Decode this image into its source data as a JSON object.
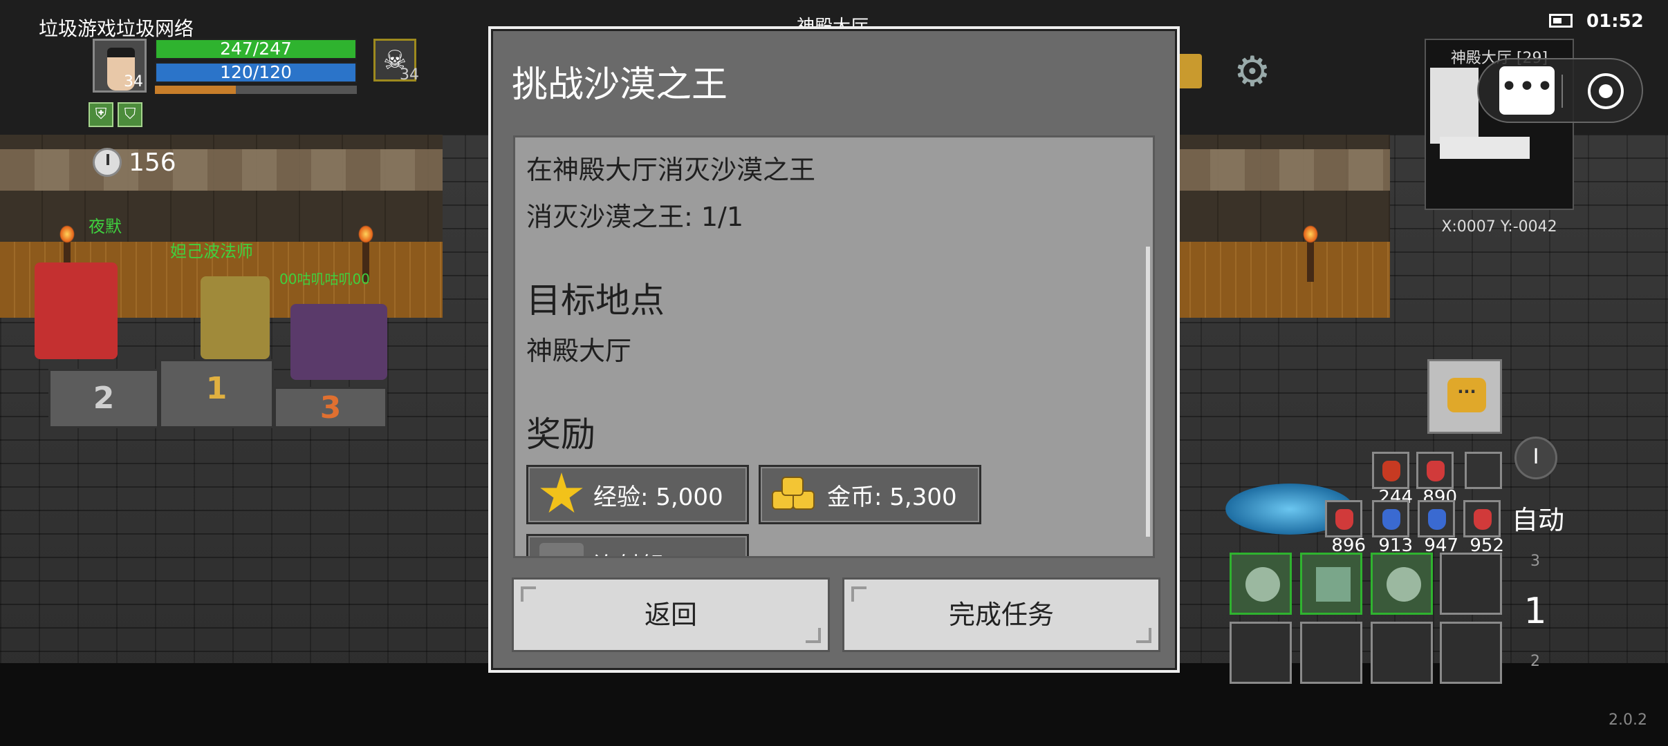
{
  "hud": {
    "app_title": "垃圾游戏垃圾网络",
    "player_level": "34",
    "hp": "247/247",
    "mp": "120/120",
    "experience_fraction": 0.4,
    "target_level": "34",
    "timer": "156"
  },
  "npcs": [
    "夜默",
    "妲己波法师",
    "00咕叽咕叽00"
  ],
  "podium": [
    "2",
    "1",
    "3"
  ],
  "location_title": "神殿大厅",
  "status_bar": {
    "time": "01:52"
  },
  "minimap": {
    "title": "神殿大厅 [29]",
    "coords": "X:0007  Y:-0042"
  },
  "dialog": {
    "title": "挑战沙漠之王",
    "description": "在神殿大厅消灭沙漠之王",
    "progress": "消灭沙漠之王: 1/1",
    "target_heading": "目标地点",
    "target_location": "神殿大厅",
    "reward_heading": "奖励",
    "rewards": {
      "exp": "经验: 5,000",
      "gold": "金币: 5,300",
      "item": "连射弩"
    },
    "back_button": "返回",
    "complete_button": "完成任务"
  },
  "quickslots": {
    "row1": [
      "244",
      "890"
    ],
    "row2": [
      "896",
      "913",
      "947",
      "952"
    ]
  },
  "controls": {
    "auto_label": "自动",
    "page_up": "3",
    "page_current": "1",
    "page_down": "2"
  },
  "version": "2.0.2",
  "colors": {
    "hp": "#2fb32f",
    "mp": "#2b74c9",
    "npc_name": "#3fd13f",
    "dialog_bg": "#6a6a6a",
    "content_bg": "#9c9c9c"
  }
}
